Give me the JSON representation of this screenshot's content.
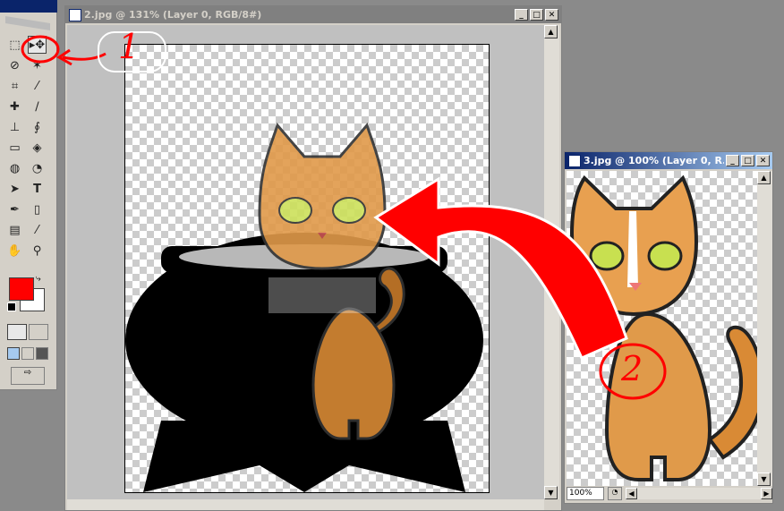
{
  "main_window": {
    "title": "2.jpg @ 131% (Layer 0, RGB/8#)",
    "icon": "document-icon",
    "buttons": [
      "minimize-icon",
      "maximize-icon",
      "close-icon"
    ]
  },
  "second_window": {
    "title": "3.jpg @ 100% (Layer 0, R...",
    "icon": "document-icon",
    "zoom": "100%"
  },
  "toolbox": {
    "tools": [
      "marquee-tool",
      "move-tool",
      "lasso-tool",
      "magic-wand-tool",
      "crop-tool",
      "slice-tool",
      "healing-brush-tool",
      "brush-tool",
      "clone-stamp-tool",
      "history-brush-tool",
      "eraser-tool",
      "paint-bucket-tool",
      "blur-tool",
      "dodge-tool",
      "path-selection-tool",
      "type-tool",
      "pen-tool",
      "rectangle-tool",
      "notes-tool",
      "eyedropper-tool",
      "hand-tool",
      "zoom-tool"
    ],
    "foreground_color": "#ff0000",
    "background_color": "#ffffff"
  },
  "annotations": {
    "step1": "1",
    "step2": "2",
    "annotation_color": "#ff0000"
  }
}
